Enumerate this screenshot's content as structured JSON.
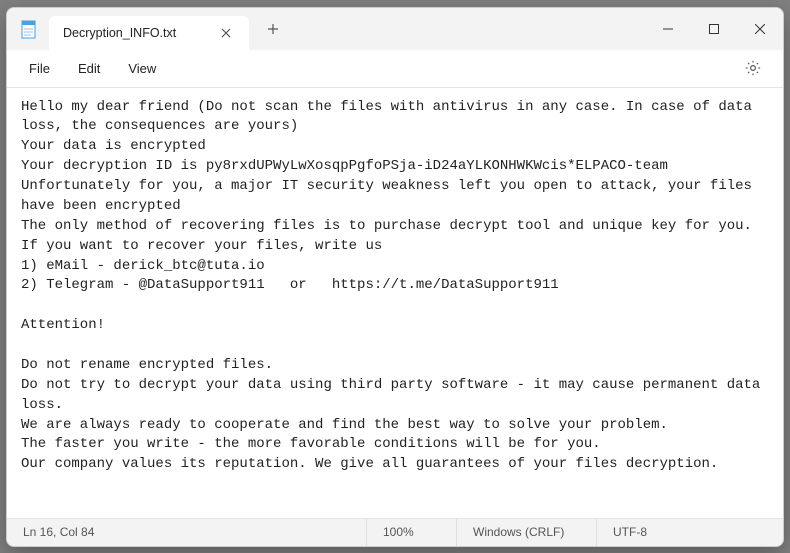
{
  "titlebar": {
    "tab_title": "Decryption_INFO.txt"
  },
  "menu": {
    "file": "File",
    "edit": "Edit",
    "view": "View"
  },
  "content": {
    "text": "Hello my dear friend (Do not scan the files with antivirus in any case. In case of data loss, the consequences are yours)\nYour data is encrypted\nYour decryption ID is py8rxdUPWyLwXosqpPgfoPSja-iD24aYLKONHWKWcis*ELPACO-team\nUnfortunately for you, a major IT security weakness left you open to attack, your files have been encrypted\nThe only method of recovering files is to purchase decrypt tool and unique key for you.\nIf you want to recover your files, write us\n1) eMail - derick_btc@tuta.io\n2) Telegram - @DataSupport911   or   https://t.me/DataSupport911\n\nAttention!\n\nDo not rename encrypted files.\nDo not try to decrypt your data using third party software - it may cause permanent data loss.\nWe are always ready to cooperate and find the best way to solve your problem.\nThe faster you write - the more favorable conditions will be for you.\nOur company values its reputation. We give all guarantees of your files decryption."
  },
  "status": {
    "cursor": "Ln 16, Col 84",
    "zoom": "100%",
    "eol": "Windows (CRLF)",
    "encoding": "UTF-8"
  }
}
